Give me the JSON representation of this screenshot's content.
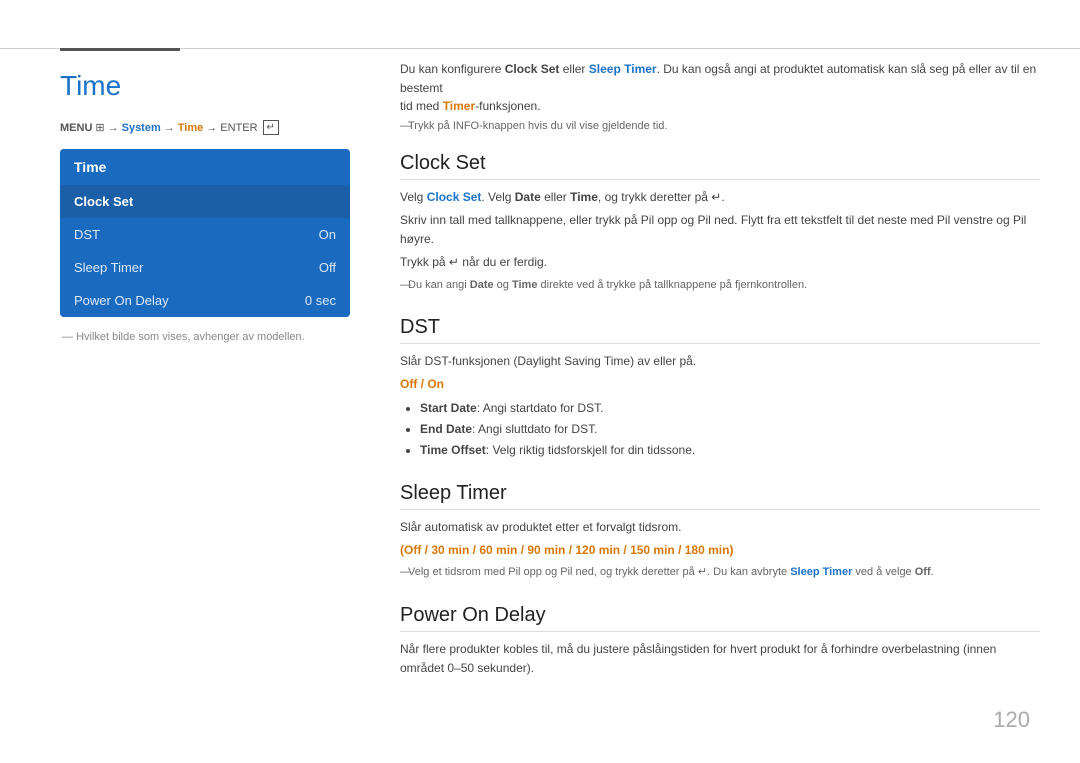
{
  "top_accent": {
    "line_label": "top-line"
  },
  "left": {
    "title": "Time",
    "menu_path": {
      "menu": "MENU",
      "separator1": "→",
      "system": "System",
      "separator2": "→",
      "time": "Time",
      "separator3": "→",
      "enter": "ENTER"
    },
    "panel": {
      "header": "Time",
      "items": [
        {
          "label": "Clock Set",
          "value": "",
          "selected": true
        },
        {
          "label": "DST",
          "value": "On",
          "selected": false
        },
        {
          "label": "Sleep Timer",
          "value": "Off",
          "selected": false
        },
        {
          "label": "Power On Delay",
          "value": "0 sec",
          "selected": false
        }
      ]
    },
    "model_note": "Hvilket bilde som vises, avhenger av modellen."
  },
  "right": {
    "intro_line1": "Du kan konfigurere Clock Set eller Sleep Timer. Du kan også angi at produktet automatisk kan slå seg på eller av til en bestemt",
    "intro_line2": "tid med Timer-funksjonen.",
    "intro_note": "Trykk på INFO-knappen hvis du vil vise gjeldende tid.",
    "sections": [
      {
        "id": "clock-set",
        "title": "Clock Set",
        "body_lines": [
          "Velg Clock Set. Velg Date eller Time, og trykk deretter på ↵.",
          "Skriv inn tall med tallknappene, eller trykk på Pil opp og Pil ned. Flytt fra ett tekstfelt til det neste med Pil venstre og Pil høyre.",
          "Trykk på ↵ når du er ferdig."
        ],
        "note": "Du kan angi Date og Time direkte ved å trykke på tallknappene på fjernkontrollen."
      },
      {
        "id": "dst",
        "title": "DST",
        "body_lines": [
          "Slår DST-funksjonen (Daylight Saving Time) av eller på."
        ],
        "off_on": "Off / On",
        "bullet_items": [
          {
            "label": "Start Date",
            "text": ": Angi startdato for DST."
          },
          {
            "label": "End Date",
            "text": ": Angi sluttdato for DST."
          },
          {
            "label": "Time Offset",
            "text": ": Velg riktig tidsforskjell for din tidssone."
          }
        ]
      },
      {
        "id": "sleep-timer",
        "title": "Sleep Timer",
        "body_lines": [
          "Slår automatisk av produktet etter et forvalgt tidsrom."
        ],
        "options": "(Off / 30 min / 60 min / 90 min / 120 min / 150 min / 180 min)",
        "note": "Velg et tidsrom med Pil opp og Pil ned, og trykk deretter på ↵. Du kan avbryte Sleep Timer ved å velge Off."
      },
      {
        "id": "power-on-delay",
        "title": "Power On Delay",
        "body_lines": [
          "Når flere produkter kobles til, må du justere påslåingstiden for hvert produkt for å forhindre overbelastning (innen området 0–50 sekunder)."
        ]
      }
    ]
  },
  "page_number": "120",
  "colors": {
    "blue": "#1a73c8",
    "orange": "#d97706",
    "panel_bg": "#1a6abf",
    "panel_selected": "#1a5fa8"
  }
}
